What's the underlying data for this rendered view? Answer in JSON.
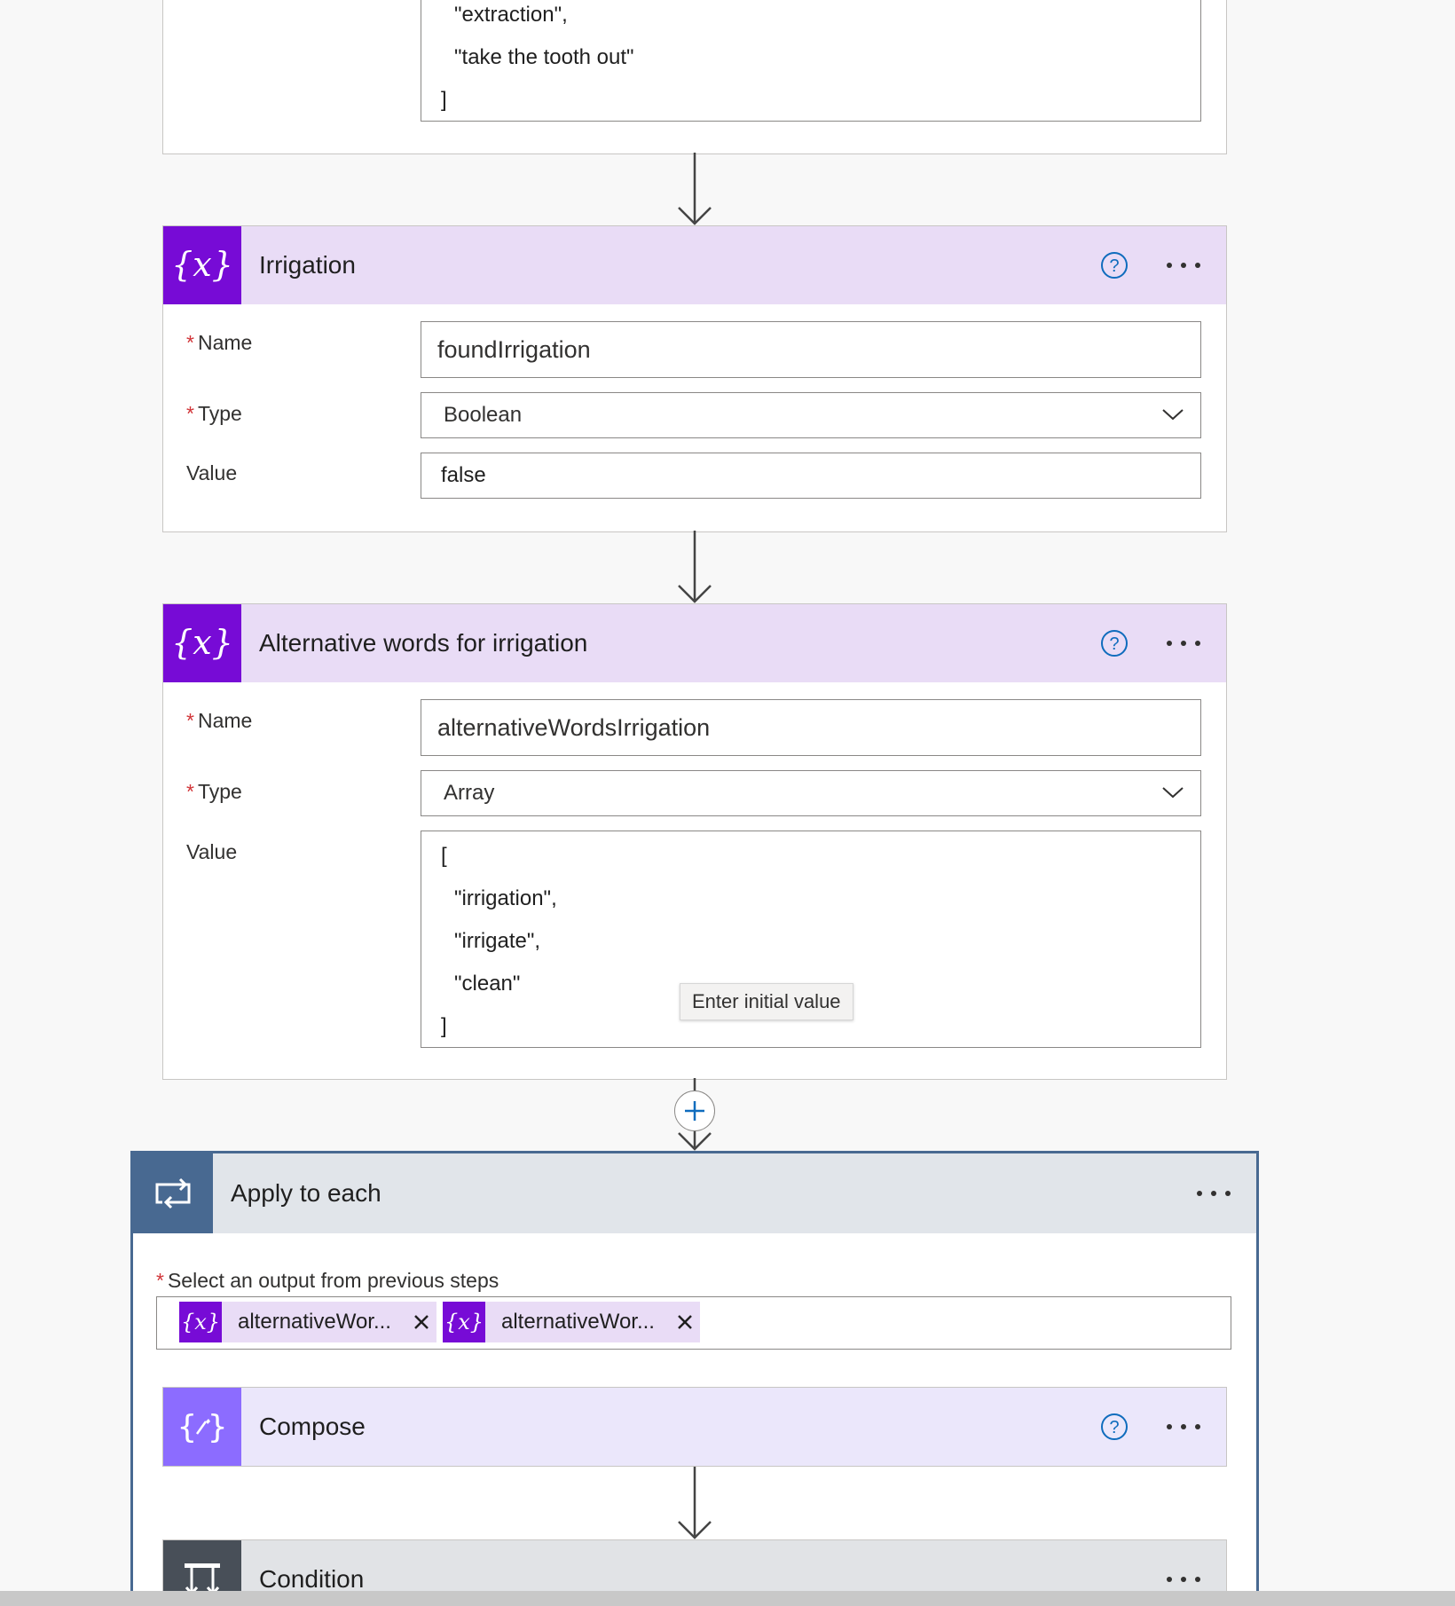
{
  "top_card": {
    "value_lines": [
      "\"extraction\",",
      "\"take the tooth out\"",
      "]"
    ]
  },
  "irrigation_card": {
    "title": "Irrigation",
    "icon": "variable-icon",
    "name_label": "Name",
    "name_value": "foundIrrigation",
    "type_label": "Type",
    "type_value": "Boolean",
    "value_label": "Value",
    "value_value": "false"
  },
  "alt_card": {
    "title": "Alternative words for irrigation",
    "icon": "variable-icon",
    "name_label": "Name",
    "name_value": "alternativeWordsIrrigation",
    "type_label": "Type",
    "type_value": "Array",
    "value_label": "Value",
    "value_open": "[",
    "value_items": [
      "\"irrigation\",",
      "\"irrigate\",",
      "\"clean\""
    ],
    "value_close": "]",
    "tooltip": "Enter initial value"
  },
  "apply_each": {
    "title": "Apply to each",
    "icon": "loop-icon",
    "select_label": "Select an output from previous steps",
    "tokens": [
      {
        "label": "alternativeWor...",
        "icon": "variable-icon"
      },
      {
        "label": "alternativeWor...",
        "icon": "variable-icon"
      }
    ]
  },
  "compose_card": {
    "title": "Compose",
    "icon": "compose-icon"
  },
  "condition_card": {
    "title": "Condition",
    "icon": "condition-icon"
  },
  "colors": {
    "variable_accent": "#770bd6",
    "variable_header": "#e9dcf6",
    "compose_accent": "#8c6cff",
    "loop_accent": "#486991",
    "condition_accent": "#484f58",
    "required": "#d13438",
    "help_blue": "#0f6cbd"
  }
}
